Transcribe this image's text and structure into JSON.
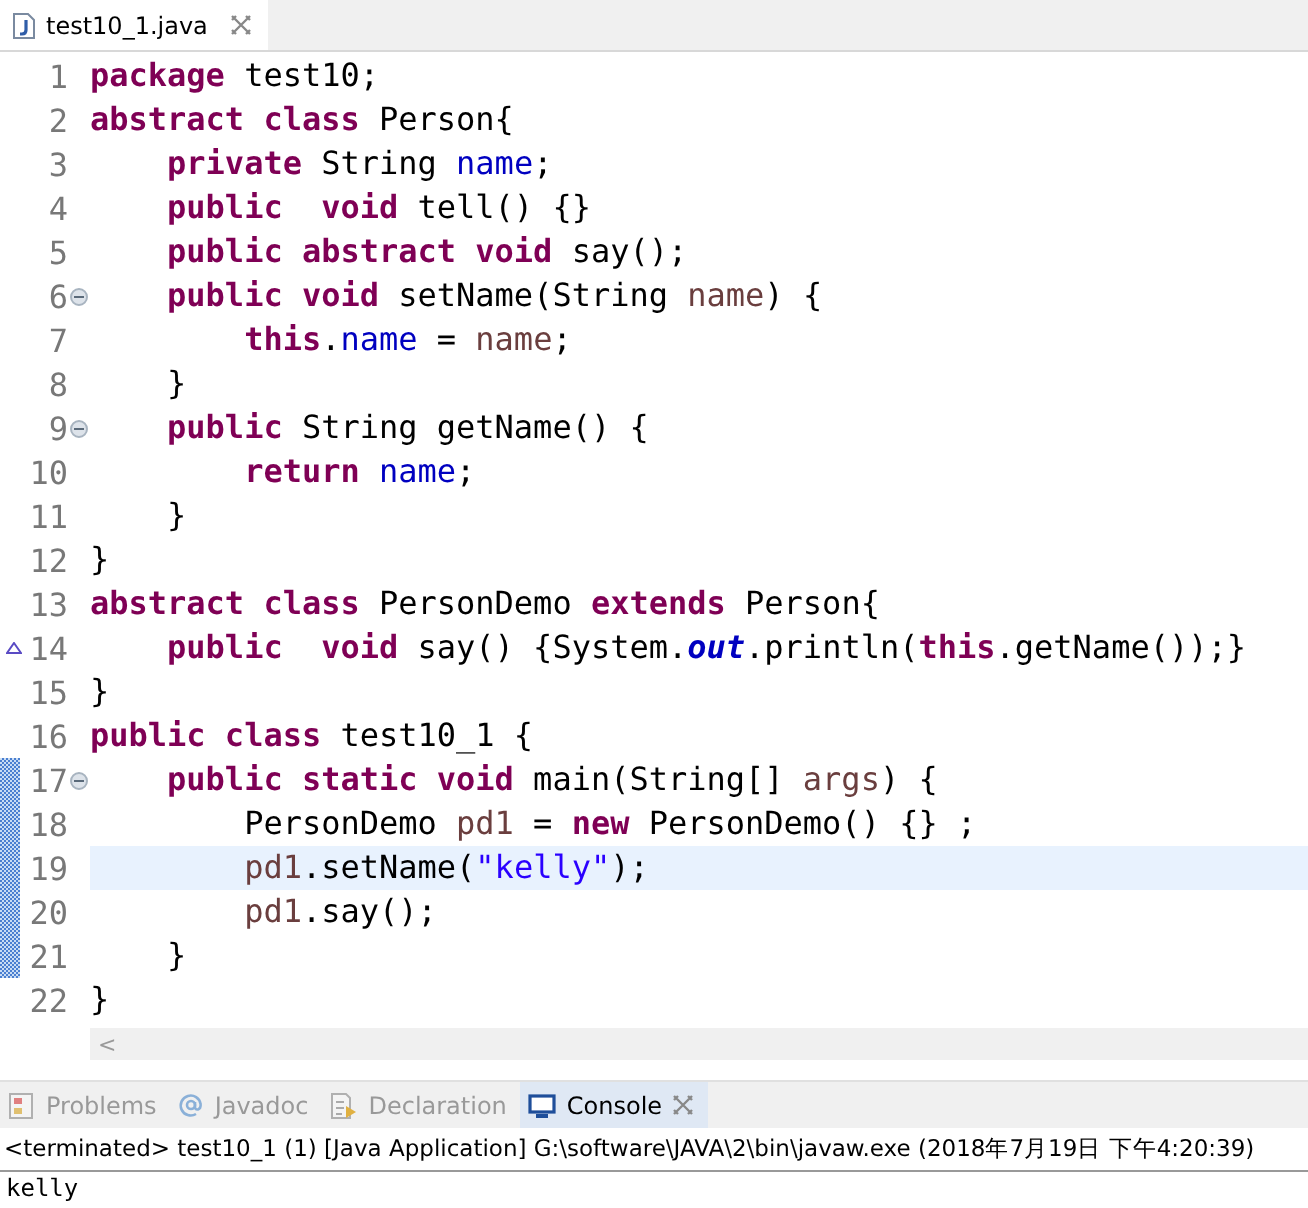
{
  "editor_tab": {
    "title": "test10_1.java",
    "selected": true
  },
  "code_lines": [
    {
      "number": "1",
      "current": false,
      "changed": false,
      "fold": false,
      "override": false,
      "tokens": [
        {
          "kind": "keyword",
          "text": "package"
        },
        {
          "kind": "plain",
          "text": " test10;"
        }
      ]
    },
    {
      "number": "2",
      "current": false,
      "changed": false,
      "fold": false,
      "override": false,
      "tokens": [
        {
          "kind": "keyword",
          "text": "abstract"
        },
        {
          "kind": "keyword",
          "text": " class"
        },
        {
          "kind": "plain",
          "text": " Person{"
        }
      ]
    },
    {
      "number": "3",
      "current": false,
      "changed": false,
      "fold": false,
      "override": false,
      "tokens": [
        {
          "kind": "keyword",
          "text": "    private"
        },
        {
          "kind": "plain",
          "text": " String"
        },
        {
          "kind": "field",
          "text": " name"
        },
        {
          "kind": "plain",
          "text": ";"
        }
      ]
    },
    {
      "number": "4",
      "current": false,
      "changed": false,
      "fold": false,
      "override": false,
      "tokens": [
        {
          "kind": "keyword",
          "text": "    public"
        },
        {
          "kind": "keyword",
          "text": "  void"
        },
        {
          "kind": "plain",
          "text": " tell() {}"
        }
      ]
    },
    {
      "number": "5",
      "current": false,
      "changed": false,
      "fold": false,
      "override": false,
      "tokens": [
        {
          "kind": "keyword",
          "text": "    public abstract void"
        },
        {
          "kind": "plain",
          "text": " say();"
        }
      ]
    },
    {
      "number": "6",
      "current": false,
      "changed": false,
      "fold": true,
      "override": false,
      "tokens": [
        {
          "kind": "keyword",
          "text": "    public void"
        },
        {
          "kind": "plain",
          "text": " setName(String"
        },
        {
          "kind": "local",
          "text": " name"
        },
        {
          "kind": "plain",
          "text": ") {"
        }
      ]
    },
    {
      "number": "7",
      "current": false,
      "changed": false,
      "fold": false,
      "override": false,
      "tokens": [
        {
          "kind": "keyword",
          "text": "        this"
        },
        {
          "kind": "plain",
          "text": "."
        },
        {
          "kind": "field",
          "text": "name"
        },
        {
          "kind": "plain",
          "text": " ="
        },
        {
          "kind": "local",
          "text": " name"
        },
        {
          "kind": "plain",
          "text": ";"
        }
      ]
    },
    {
      "number": "8",
      "current": false,
      "changed": false,
      "fold": false,
      "override": false,
      "tokens": [
        {
          "kind": "plain",
          "text": "    }"
        }
      ]
    },
    {
      "number": "9",
      "current": false,
      "changed": false,
      "fold": true,
      "override": false,
      "tokens": [
        {
          "kind": "keyword",
          "text": "    public"
        },
        {
          "kind": "plain",
          "text": " String getName() {"
        }
      ]
    },
    {
      "number": "10",
      "current": false,
      "changed": false,
      "fold": false,
      "override": false,
      "tokens": [
        {
          "kind": "keyword",
          "text": "        return"
        },
        {
          "kind": "field",
          "text": " name"
        },
        {
          "kind": "plain",
          "text": ";"
        }
      ]
    },
    {
      "number": "11",
      "current": false,
      "changed": false,
      "fold": false,
      "override": false,
      "tokens": [
        {
          "kind": "plain",
          "text": "    }"
        }
      ]
    },
    {
      "number": "12",
      "current": false,
      "changed": false,
      "fold": false,
      "override": false,
      "tokens": [
        {
          "kind": "plain",
          "text": "}"
        }
      ]
    },
    {
      "number": "13",
      "current": false,
      "changed": false,
      "fold": false,
      "override": false,
      "tokens": [
        {
          "kind": "keyword",
          "text": "abstract class"
        },
        {
          "kind": "plain",
          "text": " PersonDemo"
        },
        {
          "kind": "keyword",
          "text": " extends"
        },
        {
          "kind": "plain",
          "text": " Person{"
        }
      ]
    },
    {
      "number": "14",
      "current": false,
      "changed": false,
      "fold": false,
      "override": true,
      "tokens": [
        {
          "kind": "keyword",
          "text": "    public"
        },
        {
          "kind": "keyword",
          "text": "  void"
        },
        {
          "kind": "plain",
          "text": " say() {System."
        },
        {
          "kind": "static",
          "text": "out"
        },
        {
          "kind": "plain",
          "text": ".println("
        },
        {
          "kind": "keyword",
          "text": "this"
        },
        {
          "kind": "plain",
          "text": ".getName());}"
        }
      ]
    },
    {
      "number": "15",
      "current": false,
      "changed": false,
      "fold": false,
      "override": false,
      "tokens": [
        {
          "kind": "plain",
          "text": "}"
        }
      ]
    },
    {
      "number": "16",
      "current": false,
      "changed": false,
      "fold": false,
      "override": false,
      "tokens": [
        {
          "kind": "keyword",
          "text": "public class"
        },
        {
          "kind": "plain",
          "text": " test10_1 {"
        }
      ]
    },
    {
      "number": "17",
      "current": false,
      "changed": true,
      "fold": true,
      "override": false,
      "tokens": [
        {
          "kind": "keyword",
          "text": "    public static void"
        },
        {
          "kind": "plain",
          "text": " main(String[]"
        },
        {
          "kind": "local",
          "text": " args"
        },
        {
          "kind": "plain",
          "text": ") {"
        }
      ]
    },
    {
      "number": "18",
      "current": false,
      "changed": true,
      "fold": false,
      "override": false,
      "tokens": [
        {
          "kind": "plain",
          "text": "        PersonDemo"
        },
        {
          "kind": "local",
          "text": " pd1"
        },
        {
          "kind": "plain",
          "text": " ="
        },
        {
          "kind": "keyword",
          "text": " new"
        },
        {
          "kind": "plain",
          "text": " PersonDemo() {} ;"
        }
      ]
    },
    {
      "number": "19",
      "current": true,
      "changed": true,
      "fold": false,
      "override": false,
      "tokens": [
        {
          "kind": "local",
          "text": "        pd1"
        },
        {
          "kind": "plain",
          "text": ".setName("
        },
        {
          "kind": "string",
          "text": "\"kelly\""
        },
        {
          "kind": "plain",
          "text": ");"
        }
      ]
    },
    {
      "number": "20",
      "current": false,
      "changed": true,
      "fold": false,
      "override": false,
      "tokens": [
        {
          "kind": "local",
          "text": "        pd1"
        },
        {
          "kind": "plain",
          "text": ".say();"
        }
      ]
    },
    {
      "number": "21",
      "current": false,
      "changed": true,
      "fold": false,
      "override": false,
      "tokens": [
        {
          "kind": "plain",
          "text": "    }"
        }
      ]
    },
    {
      "number": "22",
      "current": false,
      "changed": false,
      "fold": false,
      "override": false,
      "tokens": [
        {
          "kind": "plain",
          "text": "}"
        }
      ]
    }
  ],
  "scroll_arrow": "<",
  "view_tabs": [
    {
      "kind": "problems",
      "label": "Problems",
      "selected": false
    },
    {
      "kind": "javadoc",
      "label": "Javadoc",
      "selected": false
    },
    {
      "kind": "declaration",
      "label": "Declaration",
      "selected": false
    },
    {
      "kind": "console",
      "label": "Console",
      "selected": true
    }
  ],
  "console": {
    "header": "<terminated> test10_1 (1) [Java Application] G:\\software\\JAVA\\2\\bin\\javaw.exe (2018年7月19日 下午4:20:39)",
    "output": "kelly"
  }
}
